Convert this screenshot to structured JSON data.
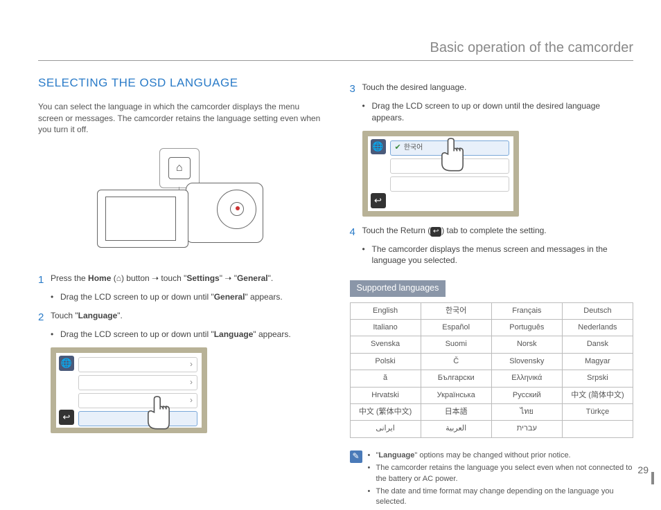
{
  "header": {
    "title": "Basic operation of the camcorder"
  },
  "section_title": "SELECTING THE OSD LANGUAGE",
  "intro": "You can select the language in which the camcorder displays the menu screen or messages. The camcorder retains the language setting even when you turn it off.",
  "home_icon": "⌂",
  "steps": {
    "s1": {
      "num": "1",
      "text_a": "Press the ",
      "home": "Home",
      "text_b": " (",
      "icon": "⌂",
      "text_c": ") button ",
      "arrow": "➝",
      "text_d": " touch \"",
      "settings": "Settings",
      "quote1": "\" ",
      "arrow2": "➝",
      "quote2": " \"",
      "general": "General",
      "text_e": "\".",
      "bullet_a": "Drag the LCD screen to up or down until \"",
      "bullet_b": "General",
      "bullet_c": "\" appears."
    },
    "s2": {
      "num": "2",
      "text_a": "Touch \"",
      "lang": "Language",
      "text_b": "\".",
      "bullet_a": "Drag the LCD screen to up or down until \"",
      "bullet_b": "Language",
      "bullet_c": "\" appears."
    },
    "s3": {
      "num": "3",
      "text": "Touch the desired language.",
      "bullet": "Drag the LCD screen to up or down until the desired language appears."
    },
    "s4": {
      "num": "4",
      "text_a": "Touch the Return (",
      "icon": "↩",
      "text_b": ") tab to complete the setting.",
      "bullet": "The camcorder displays the menus screen and messages in the language you selected."
    }
  },
  "lcd": {
    "globe": "🌐",
    "back": "↩",
    "chevron": "›",
    "selected_label": "한국어",
    "check": "✔"
  },
  "langs_title": "Supported languages",
  "langs": [
    [
      "English",
      "한국어",
      "Français",
      "Deutsch"
    ],
    [
      "Italiano",
      "Español",
      "Português",
      "Nederlands"
    ],
    [
      "Svenska",
      "Suomi",
      "Norsk",
      "Dansk"
    ],
    [
      "Polski",
      "Č",
      "Slovensky",
      "Magyar"
    ],
    [
      "ă",
      "Български",
      "Ελληνικά",
      "Srpski"
    ],
    [
      "Hrvatski",
      "Українська",
      "Русский",
      "中文 (简体中文)"
    ],
    [
      "中文 (繁体中文)",
      "日本語",
      "ไทย",
      "Türkçe"
    ],
    [
      "ایرانی",
      "العربية",
      "עברית",
      ""
    ]
  ],
  "notes": {
    "icon": "✎",
    "n1_a": "\"",
    "n1_b": "Language",
    "n1_c": "\" options may be changed without prior notice.",
    "n2": "The camcorder retains the language you select even when not connected to the battery or AC power.",
    "n3": "The date and time format may change depending on the language you selected."
  },
  "page_number": "29"
}
